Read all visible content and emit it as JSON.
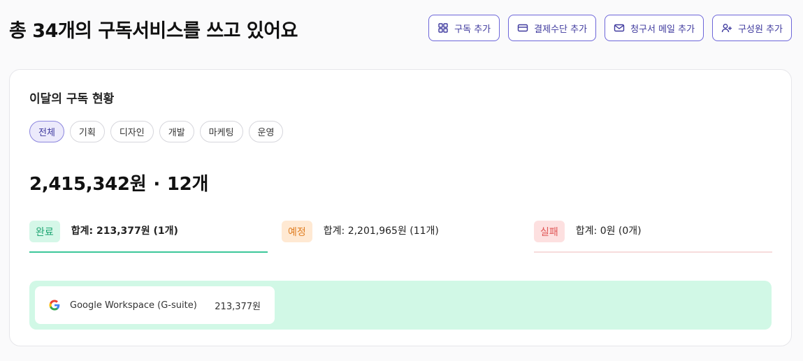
{
  "header": {
    "title": "총 34개의 구독서비스를 쓰고 있어요",
    "actions": [
      {
        "label": "구독 추가",
        "icon": "grid-icon"
      },
      {
        "label": "결제수단 추가",
        "icon": "credit-card-icon"
      },
      {
        "label": "청구서 메일 추가",
        "icon": "mail-icon"
      },
      {
        "label": "구성원 추가",
        "icon": "user-plus-icon"
      }
    ]
  },
  "summary": {
    "title": "이달의 구독 현황",
    "filters": [
      "전체",
      "기획",
      "디자인",
      "개발",
      "마케팅",
      "운영"
    ],
    "active_filter": "전체",
    "total_amount": "2,415,342원",
    "separator": "·",
    "total_count": "12개",
    "statuses": [
      {
        "label": "완료",
        "sum": "합계: 213,377원 (1개)"
      },
      {
        "label": "예정",
        "sum": "합계: 2,201,965원 (11개)"
      },
      {
        "label": "실패",
        "sum": "합계: 0원 (0개)"
      }
    ],
    "items": [
      {
        "name": "Google Workspace (G-suite)",
        "amount": "213,377원",
        "icon": "google-icon"
      }
    ]
  },
  "colors": {
    "accent": "#6d66d9",
    "done": "#3cc79a",
    "scheduled": "#e07f24",
    "failed": "#e05656"
  }
}
